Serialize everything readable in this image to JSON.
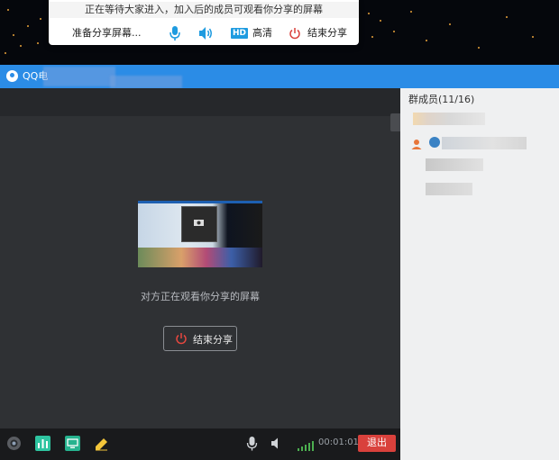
{
  "toast": {
    "message": "正在等待大家进入，加入后的成员可观看你分享的屏幕",
    "prepare_label": "准备分享屏幕...",
    "hd_badge": "HD",
    "hd_label": "高清",
    "end_share_label": "结束分享"
  },
  "window": {
    "title": "QQ电"
  },
  "main": {
    "status_text": "对方正在观看你分享的屏幕",
    "end_share_button": "结束分享"
  },
  "bottombar": {
    "timer": "00:01:01",
    "exit_label": "退出"
  },
  "sidebar": {
    "header": "群成员(11/16)"
  },
  "colors": {
    "titlebar": "#2b8ce6",
    "accent": "#1e9be0",
    "danger": "#d9413c",
    "signal": "#4caf50"
  },
  "icons": [
    "microphone-icon",
    "speaker-icon",
    "power-icon",
    "camera-icon",
    "chart-icon",
    "screen-share-icon",
    "pencil-icon",
    "volume-icon",
    "signal-icon",
    "user-icon"
  ]
}
